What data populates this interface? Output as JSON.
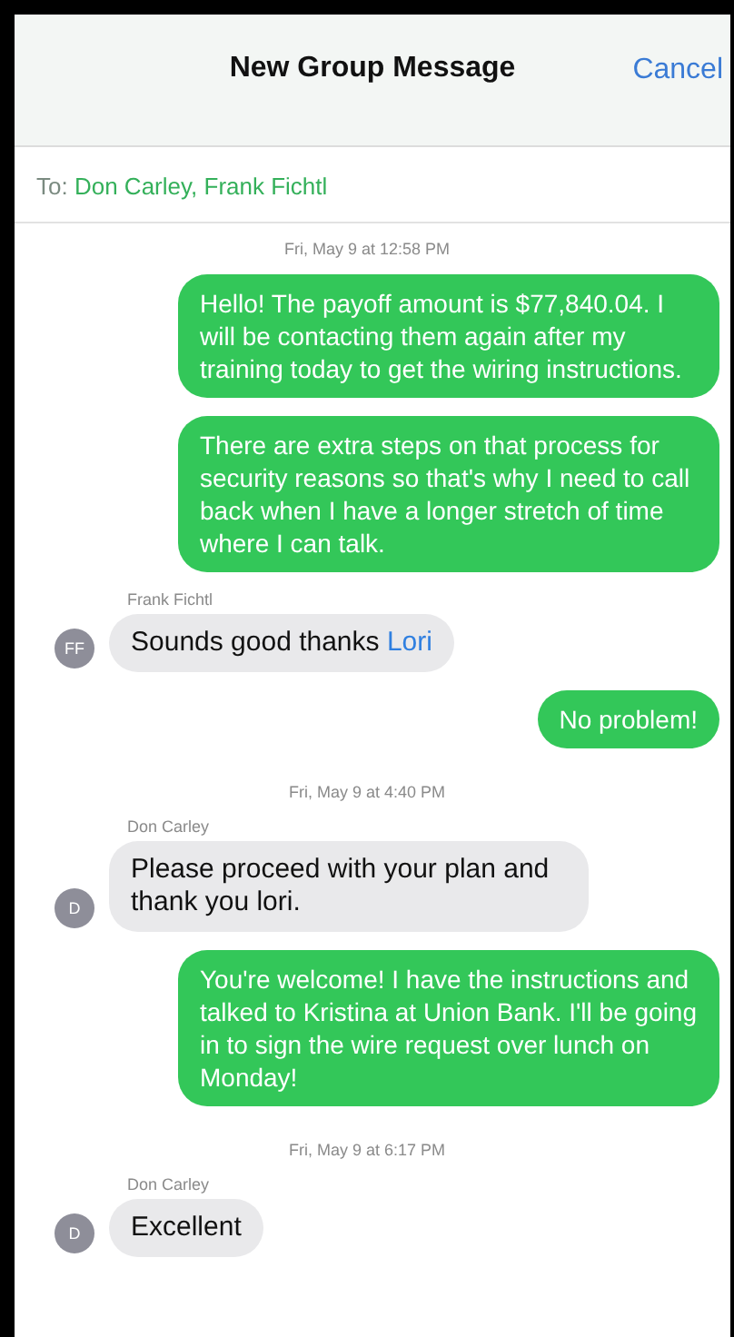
{
  "header": {
    "title": "New Group Message",
    "cancel": "Cancel"
  },
  "recipients": {
    "label": "To:",
    "names": "Don Carley, Frank Fichtl"
  },
  "messages": [
    {
      "kind": "timestamp",
      "text": "Fri, May 9 at 12:58 PM"
    },
    {
      "kind": "outgoing",
      "text": "Hello!  The payoff amount is $77,840.04.  I will be contacting them again after my training today to get the wiring instructions."
    },
    {
      "kind": "outgoing",
      "text": "There are extra steps on that process for security reasons so that's why I need to call back when I have a longer stretch of time where I can talk."
    },
    {
      "kind": "incoming",
      "sender": "Frank Fichtl",
      "initials": "FF",
      "segments": [
        {
          "kind": "plain",
          "text": "Sounds good thanks "
        },
        {
          "kind": "link",
          "text": "Lori"
        }
      ]
    },
    {
      "kind": "outgoing",
      "text": "No problem!"
    },
    {
      "kind": "timestamp",
      "text": "Fri, May 9 at 4:40 PM"
    },
    {
      "kind": "incoming",
      "sender": "Don Carley",
      "initials": "D",
      "segments": [
        {
          "kind": "plain",
          "text": "Please proceed with your plan and thank you lori."
        }
      ]
    },
    {
      "kind": "outgoing",
      "text": "You're welcome!  I have the instructions and talked to Kristina at Union Bank.  I'll be going in to sign the wire request over lunch on Monday!"
    },
    {
      "kind": "timestamp",
      "text": "Fri, May 9 at 6:17 PM"
    },
    {
      "kind": "incoming",
      "sender": "Don Carley",
      "initials": "D",
      "segments": [
        {
          "kind": "plain",
          "text": "Excellent"
        }
      ]
    }
  ]
}
